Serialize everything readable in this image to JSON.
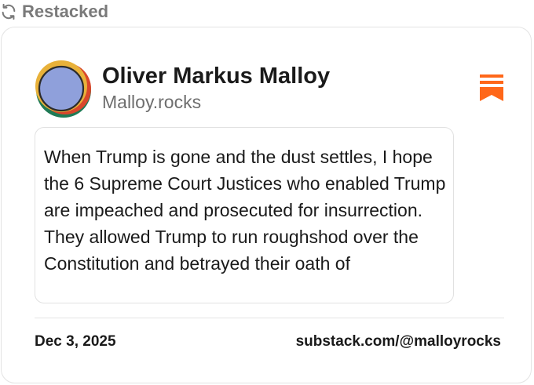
{
  "restack": {
    "label": "Restacked",
    "icon": "restack-icon"
  },
  "author": {
    "name": "Oliver Markus Malloy",
    "handle": "Malloy.rocks",
    "avatar_icon": "avatar-icon"
  },
  "brand": {
    "icon": "substack-logo-icon",
    "accent_color": "#ff6719"
  },
  "post": {
    "text": "When Trump is gone and the dust settles, I hope the 6 Supreme Court Justices who enabled Trump are impeached and prosecuted for insurrection. They allowed Trump to run roughshod over the Constitution and betrayed their oath of"
  },
  "footer": {
    "date": "Dec 3, 2025",
    "link": "substack.com/@malloyrocks"
  },
  "colors": {
    "muted_text": "#7a7a7a",
    "border": "#e3e3e3"
  }
}
